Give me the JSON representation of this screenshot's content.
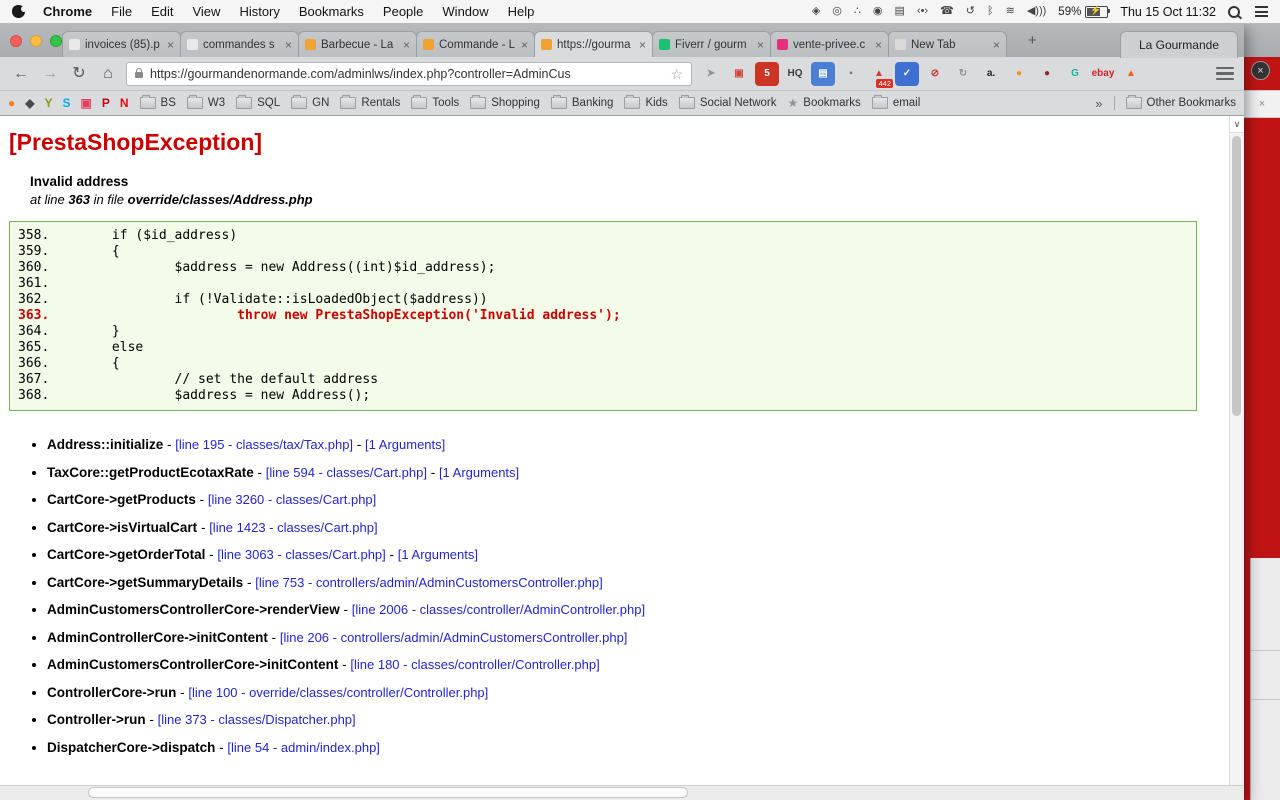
{
  "menubar": {
    "items": [
      "Chrome",
      "File",
      "Edit",
      "View",
      "History",
      "Bookmarks",
      "People",
      "Window",
      "Help"
    ],
    "status_icons": [
      {
        "name": "dropbox-icon",
        "glyph": "◈"
      },
      {
        "name": "shield-icon",
        "glyph": "◎"
      },
      {
        "name": "paw-icon",
        "glyph": "∴"
      },
      {
        "name": "disc-icon",
        "glyph": "◉"
      },
      {
        "name": "display-icon",
        "glyph": "▤"
      },
      {
        "name": "keyboard-viewer-icon",
        "glyph": "‹•›"
      },
      {
        "name": "phone-icon",
        "glyph": "☎"
      },
      {
        "name": "time-machine-icon",
        "glyph": "↺"
      },
      {
        "name": "bluetooth-icon",
        "glyph": "ᛒ"
      },
      {
        "name": "wifi-icon",
        "glyph": "≋"
      },
      {
        "name": "volume-icon",
        "glyph": "◀)))"
      }
    ],
    "battery": {
      "percent": "59%",
      "bolt": "⚡"
    },
    "clock": "Thu 15 Oct 11:32"
  },
  "window": {
    "glyphs": {
      "close": "×",
      "new_tab": "+",
      "scroll_chevron": "∨"
    },
    "profile_button": "La Gourmande",
    "tabs": [
      {
        "title": "invoices (85).p",
        "color": "#e9e9e9"
      },
      {
        "title": "commandes s",
        "color": "#e9e9e9"
      },
      {
        "title": "Barbecue - La",
        "color": "#f0a232"
      },
      {
        "title": "Commande - L",
        "color": "#f0a232"
      },
      {
        "title": "https://gourma",
        "color": "#f0a232",
        "active": true
      },
      {
        "title": "Fiverr / gourm",
        "color": "#1dbf73"
      },
      {
        "title": "vente-privee.c",
        "color": "#e6327d"
      },
      {
        "title": "New Tab",
        "color": "#dadada"
      }
    ],
    "toolbar": {
      "back": "←",
      "forward": "→",
      "reload": "↻",
      "home": "⌂",
      "url": "https://gourmandenormande.com/adminlws/index.php?controller=AdminCus",
      "bookmark_star": "☆",
      "extensions": [
        {
          "name": "pin-extension-icon",
          "glyph": "➤",
          "fg": "#8f9296"
        },
        {
          "name": "flag-extension-icon",
          "glyph": "▣",
          "fg": "#d6453c"
        },
        {
          "name": "adblock-extension-icon",
          "glyph": "5",
          "fg": "#ffffff",
          "bg": "#cc3426"
        },
        {
          "name": "cloudhq-extension-icon",
          "glyph": "HQ",
          "fg": "#3c3c3c"
        },
        {
          "name": "notes-extension-icon",
          "glyph": "▤",
          "fg": "#ffffff",
          "bg": "#4a7fd4"
        },
        {
          "name": "key-extension-icon",
          "glyph": "▪",
          "fg": "#7a7d80"
        },
        {
          "name": "alert-extension-icon",
          "glyph": "▲",
          "fg": "#cf3b2f",
          "badge": "442"
        },
        {
          "name": "check-extension-icon",
          "glyph": "✓",
          "fg": "#ffffff",
          "bg": "#3f6fd1"
        },
        {
          "name": "blocked-extension-icon",
          "glyph": "⊘",
          "fg": "#c7372f"
        },
        {
          "name": "refresh-extension-icon",
          "glyph": "↻",
          "fg": "#8f9296"
        },
        {
          "name": "amazon-extension-icon",
          "glyph": "a.",
          "fg": "#222222"
        },
        {
          "name": "honey-extension-icon",
          "glyph": "●",
          "fg": "#f0932b"
        },
        {
          "name": "pocket-extension-icon",
          "glyph": "●",
          "fg": "#8e2430"
        },
        {
          "name": "grammarly-extension-icon",
          "glyph": "G",
          "fg": "#15b79a"
        },
        {
          "name": "ebay-extension-icon",
          "glyph": "ebay",
          "fg": "#cc2127"
        },
        {
          "name": "flame-extension-icon",
          "glyph": "▲",
          "fg": "#f25c1f"
        }
      ]
    },
    "bookmarks": {
      "favicons": [
        {
          "name": "firefox-icon",
          "glyph": "●",
          "fg": "#f38020"
        },
        {
          "name": "bird-icon",
          "glyph": "◆",
          "fg": "#4a4a4a"
        },
        {
          "name": "y-icon",
          "glyph": "Y",
          "fg": "#8a9a16"
        },
        {
          "name": "skype-icon",
          "glyph": "S",
          "fg": "#00aff0"
        },
        {
          "name": "camera-icon",
          "glyph": "▣",
          "fg": "#e4405f"
        },
        {
          "name": "pinterest-icon",
          "glyph": "P",
          "fg": "#bd081c"
        },
        {
          "name": "netflix-icon",
          "glyph": "N",
          "fg": "#e50914"
        }
      ],
      "folders": [
        {
          "label": "BS"
        },
        {
          "label": "W3"
        },
        {
          "label": "SQL"
        },
        {
          "label": "GN"
        },
        {
          "label": "Rentals"
        },
        {
          "label": "Tools"
        },
        {
          "label": "Shopping"
        },
        {
          "label": "Banking"
        },
        {
          "label": "Kids"
        },
        {
          "label": "Social Network"
        }
      ],
      "star_item": "Bookmarks",
      "email_folder": "email",
      "overflow": "»",
      "other_bookmarks": "Other Bookmarks"
    }
  },
  "page": {
    "title": "[PrestaShopException]",
    "message": "Invalid address",
    "location_prefix": "at line",
    "line_number": "363",
    "location_mid": "in file",
    "file_path": "override/classes/Address.php",
    "code": [
      {
        "text": "358.        if ($id_address)"
      },
      {
        "text": "359.        {"
      },
      {
        "text": "360.                $address = new Address((int)$id_address);"
      },
      {
        "text": "361."
      },
      {
        "text": "362.                if (!Validate::isLoadedObject($address))"
      },
      {
        "text": "363.                        throw new PrestaShopException('Invalid address');",
        "error": true
      },
      {
        "text": "364.        }"
      },
      {
        "text": "365.        else"
      },
      {
        "text": "366.        {"
      },
      {
        "text": "367.                // set the default address"
      },
      {
        "text": "368.                $address = new Address();"
      }
    ],
    "stack": [
      {
        "name": "Address::initialize",
        "sep1": " - ",
        "link": "[line 195 - classes/tax/Tax.php]",
        "sep2": " - ",
        "args": "[1 Arguments]"
      },
      {
        "name": "TaxCore::getProductEcotaxRate",
        "sep1": " - ",
        "link": "[line 594 - classes/Cart.php]",
        "sep2": " - ",
        "args": "[1 Arguments]"
      },
      {
        "name": "CartCore->getProducts",
        "sep1": " - ",
        "link": "[line 3260 - classes/Cart.php]"
      },
      {
        "name": "CartCore->isVirtualCart",
        "sep1": " - ",
        "link": "[line 1423 - classes/Cart.php]"
      },
      {
        "name": "CartCore->getOrderTotal",
        "sep1": " - ",
        "link": "[line 3063 - classes/Cart.php]",
        "sep2": " - ",
        "args": "[1 Arguments]"
      },
      {
        "name": "CartCore->getSummaryDetails",
        "sep1": " - ",
        "link": "[line 753 - controllers/admin/AdminCustomersController.php]"
      },
      {
        "name": "AdminCustomersControllerCore->renderView",
        "sep1": " - ",
        "link": "[line 2006 - classes/controller/AdminController.php]"
      },
      {
        "name": "AdminControllerCore->initContent",
        "sep1": " - ",
        "link": "[line 206 - controllers/admin/AdminCustomersController.php]"
      },
      {
        "name": "AdminCustomersControllerCore->initContent",
        "sep1": " - ",
        "link": "[line 180 - classes/controller/Controller.php]"
      },
      {
        "name": "ControllerCore->run",
        "sep1": " - ",
        "link": "[line 100 - override/classes/controller/Controller.php]"
      },
      {
        "name": "Controller->run",
        "sep1": " - ",
        "link": "[line 373 - classes/Dispatcher.php]"
      },
      {
        "name": "DispatcherCore->dispatch",
        "sep1": " - ",
        "link": "[line 54 - admin/index.php]"
      }
    ]
  },
  "background": {
    "close_x": "×",
    "circle_x": "×"
  },
  "colors": {
    "error_red": "#cc0000",
    "code_bg": "#f2fce9",
    "code_border": "#74b74f",
    "link_blue": "#2424cf",
    "desktop_red": "#c01414"
  }
}
